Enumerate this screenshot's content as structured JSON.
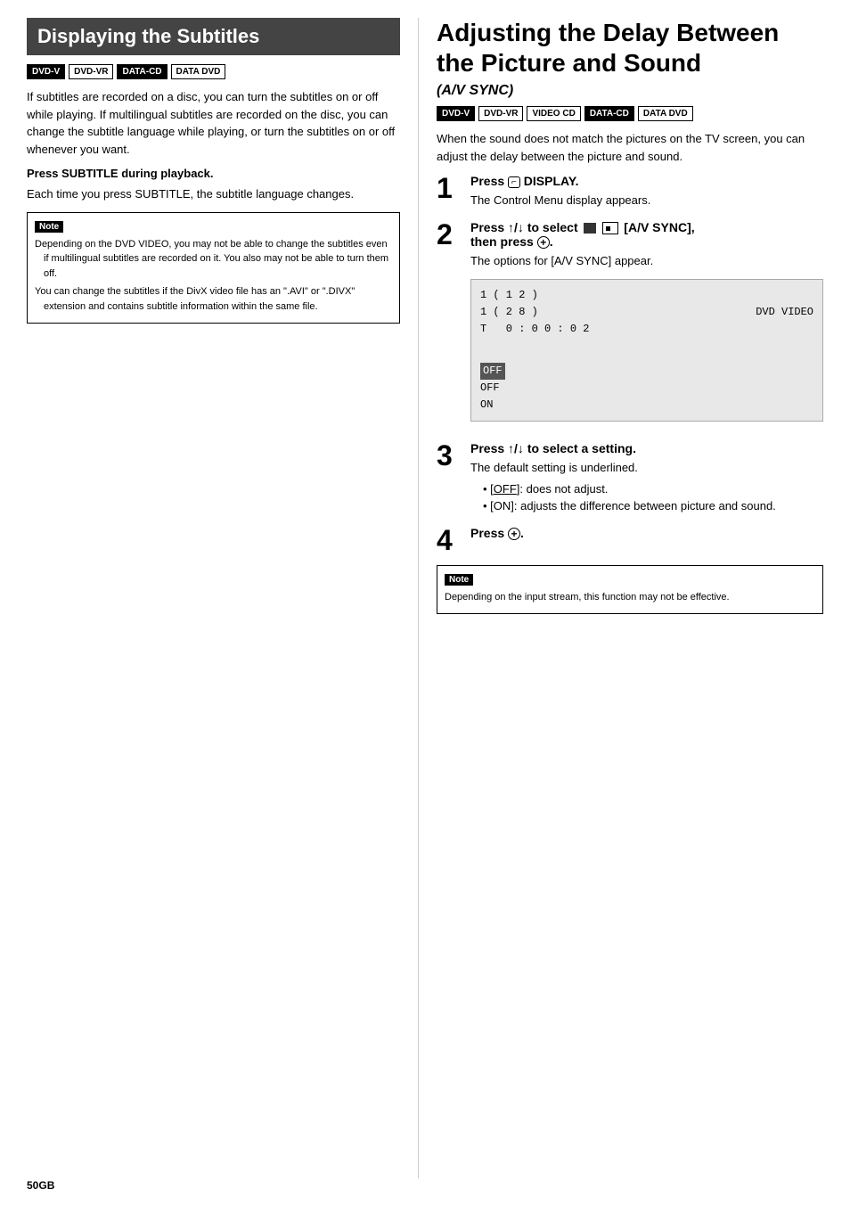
{
  "page": {
    "number": "50",
    "number_suffix": "GB"
  },
  "left": {
    "title": "Displaying the Subtitles",
    "badges": [
      "DVD-V",
      "DVD-VR",
      "DATA-CD",
      "DATA DVD"
    ],
    "badges_filled": [
      "DVD-V"
    ],
    "intro": "If subtitles are recorded on a disc, you can turn the subtitles on or off while playing. If multilingual subtitles are recorded on the disc, you can change the subtitle language while playing, or turn the subtitles on or off whenever you want.",
    "subsection_title": "Press SUBTITLE during playback.",
    "subsection_text": "Each time you press SUBTITLE, the subtitle language changes.",
    "note_label": "Note",
    "notes": [
      "Depending on the DVD VIDEO, you may not be able to change the subtitles even if multilingual subtitles are recorded on it. You also may not be able to turn them off.",
      "You can change the subtitles if the DivX video file has an \".AVI\" or \".DIVX\" extension and contains subtitle information within the same file."
    ]
  },
  "right": {
    "title": "Adjusting the Delay Between the Picture and Sound",
    "subtitle": "(A/V SYNC)",
    "badges": [
      "DVD-V",
      "DVD-VR",
      "VIDEO CD",
      "DATA-CD",
      "DATA DVD"
    ],
    "badges_filled": [
      "DVD-V"
    ],
    "intro": "When the sound does not match the pictures on the TV screen, you can adjust the delay between the picture and sound.",
    "steps": [
      {
        "number": "1",
        "title": "Press  DISPLAY.",
        "desc": "The Control Menu display appears."
      },
      {
        "number": "2",
        "title": "Press ↑/↓ to select  [A/V SYNC], then press ⊕.",
        "desc": "The options for [A/V SYNC] appear."
      },
      {
        "number": "3",
        "title": "Press ↑/↓ to select a setting.",
        "desc_lines": [
          "The default setting is underlined.",
          "[OFF]: does not adjust.",
          "[ON]: adjusts the difference between picture and sound."
        ]
      },
      {
        "number": "4",
        "title": "Press ⊕."
      }
    ],
    "screen": {
      "rows": [
        {
          "left": "1 ( 1 2 )",
          "right": ""
        },
        {
          "left": "1 ( 2 8 )",
          "right": "DVD VIDEO"
        },
        {
          "left": "T   0 : 0 0 : 0 2",
          "right": ""
        },
        {
          "left": "",
          "right": ""
        },
        {
          "left": "OFF",
          "right": "",
          "highlight": true
        },
        {
          "left": "OFF",
          "right": ""
        },
        {
          "left": "ON",
          "right": ""
        }
      ]
    },
    "note_label": "Note",
    "notes": [
      "Depending on the input stream, this function may not be effective."
    ]
  }
}
